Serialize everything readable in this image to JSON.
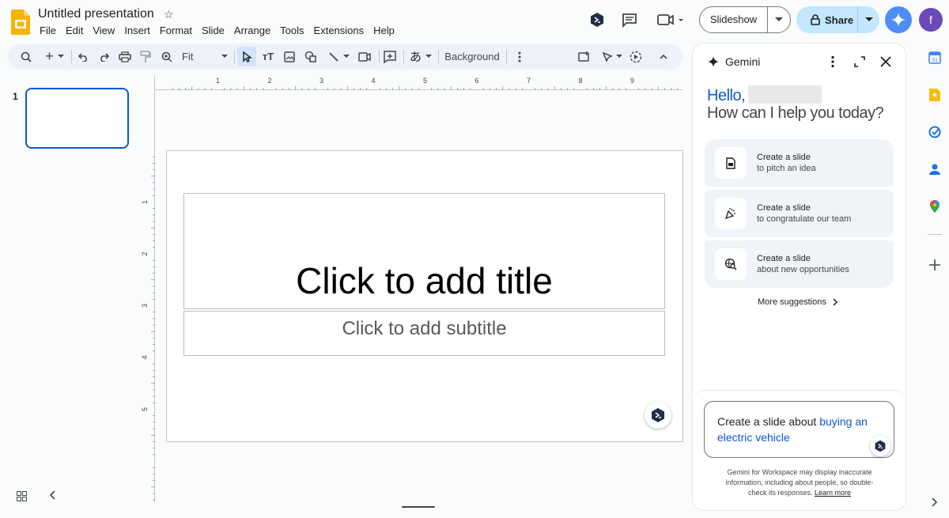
{
  "header": {
    "doc_title": "Untitled presentation",
    "menu": [
      "File",
      "Edit",
      "View",
      "Insert",
      "Format",
      "Slide",
      "Arrange",
      "Tools",
      "Extensions",
      "Help"
    ],
    "slideshow_label": "Slideshow",
    "share_label": "Share",
    "avatar_letter": "f"
  },
  "toolbar": {
    "zoom_label": "Fit",
    "background_label": "Background",
    "input_tool_glyph": "あ"
  },
  "filmstrip": {
    "slide_number": "1"
  },
  "slide": {
    "title_placeholder": "Click to add title",
    "subtitle_placeholder": "Click to add subtitle"
  },
  "rulers": {
    "h_labels": [
      "1",
      "2",
      "3",
      "4",
      "5",
      "6",
      "7",
      "8",
      "9"
    ],
    "v_labels": [
      "1",
      "2",
      "3",
      "4",
      "5"
    ]
  },
  "gemini": {
    "panel_title": "Gemini",
    "hello": "Hello,",
    "help": "How can I help you today?",
    "suggestions": [
      {
        "line1": "Create a slide",
        "line2": "to pitch an idea",
        "icon": "slide-doc-icon"
      },
      {
        "line1": "Create a slide",
        "line2": "to congratulate our team",
        "icon": "party-popper-icon"
      },
      {
        "line1": "Create a slide",
        "line2": "about new opportunities",
        "icon": "globe-search-icon"
      }
    ],
    "more_suggestions": "More suggestions",
    "prompt_prefix": "Create a slide about ",
    "prompt_highlight": "buying an electric vehicle",
    "disclaimer": "Gemini for Workspace may display inaccurate information, including about people, so double-check its responses.",
    "learn_more": "Learn more"
  },
  "colors": {
    "accent": "#0b57d0",
    "share_bg": "#c2e7ff",
    "toolbar_bg": "#edf2fa",
    "logo_yellow": "#f4b400"
  }
}
